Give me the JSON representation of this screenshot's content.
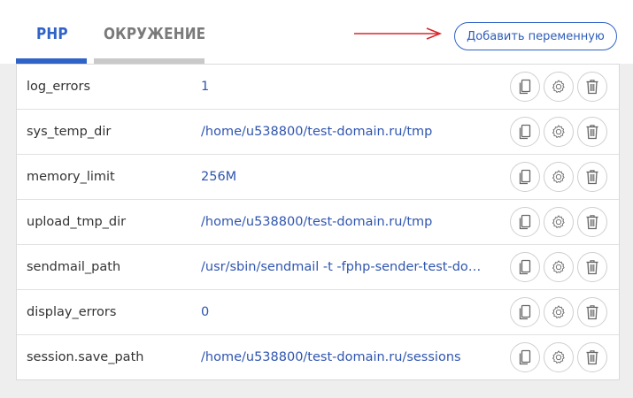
{
  "tabs": [
    {
      "label": "PHP",
      "active": true
    },
    {
      "label": "ОКРУЖЕНИЕ",
      "active": false
    }
  ],
  "add_button_label": "Добавить переменную",
  "colors": {
    "accent": "#2f63c8",
    "value_text": "#2f55b0",
    "arrow": "#d9262b",
    "inactive_tab": "#c9c9c9"
  },
  "row_actions_icons": [
    "copy-icon",
    "gear-icon",
    "trash-icon"
  ],
  "rows": [
    {
      "name": "log_errors",
      "value": "1"
    },
    {
      "name": "sys_temp_dir",
      "value": "/home/u538800/test-domain.ru/tmp"
    },
    {
      "name": "memory_limit",
      "value": "256M"
    },
    {
      "name": "upload_tmp_dir",
      "value": "/home/u538800/test-domain.ru/tmp"
    },
    {
      "name": "sendmail_path",
      "value": "/usr/sbin/sendmail -t -fphp-sender-test-domain.ru"
    },
    {
      "name": "display_errors",
      "value": "0"
    },
    {
      "name": "session.save_path",
      "value": "/home/u538800/test-domain.ru/sessions"
    }
  ]
}
